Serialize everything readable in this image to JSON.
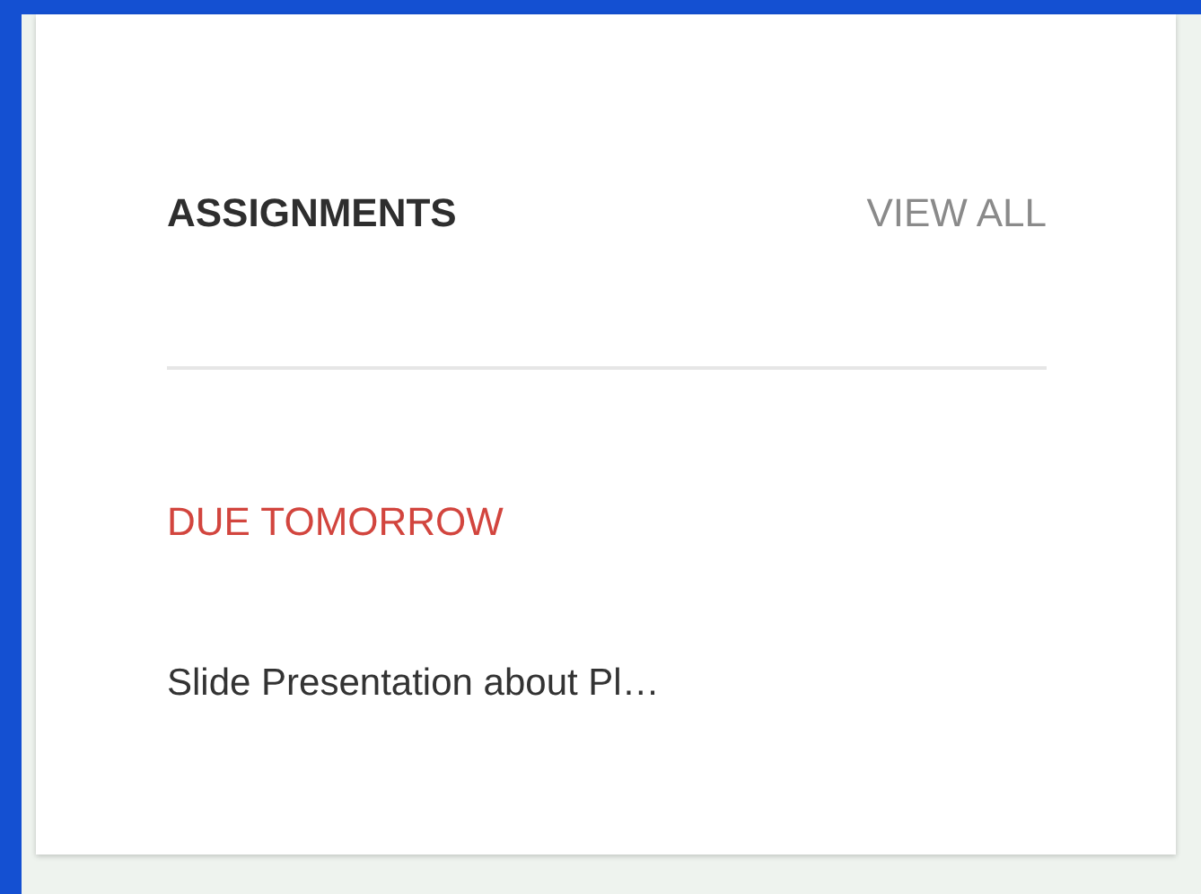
{
  "card": {
    "title": "ASSIGNMENTS",
    "view_all": "VIEW ALL",
    "sections": [
      {
        "heading": "DUE TOMORROW",
        "items": [
          "Slide Presentation about Pl…"
        ]
      }
    ]
  }
}
